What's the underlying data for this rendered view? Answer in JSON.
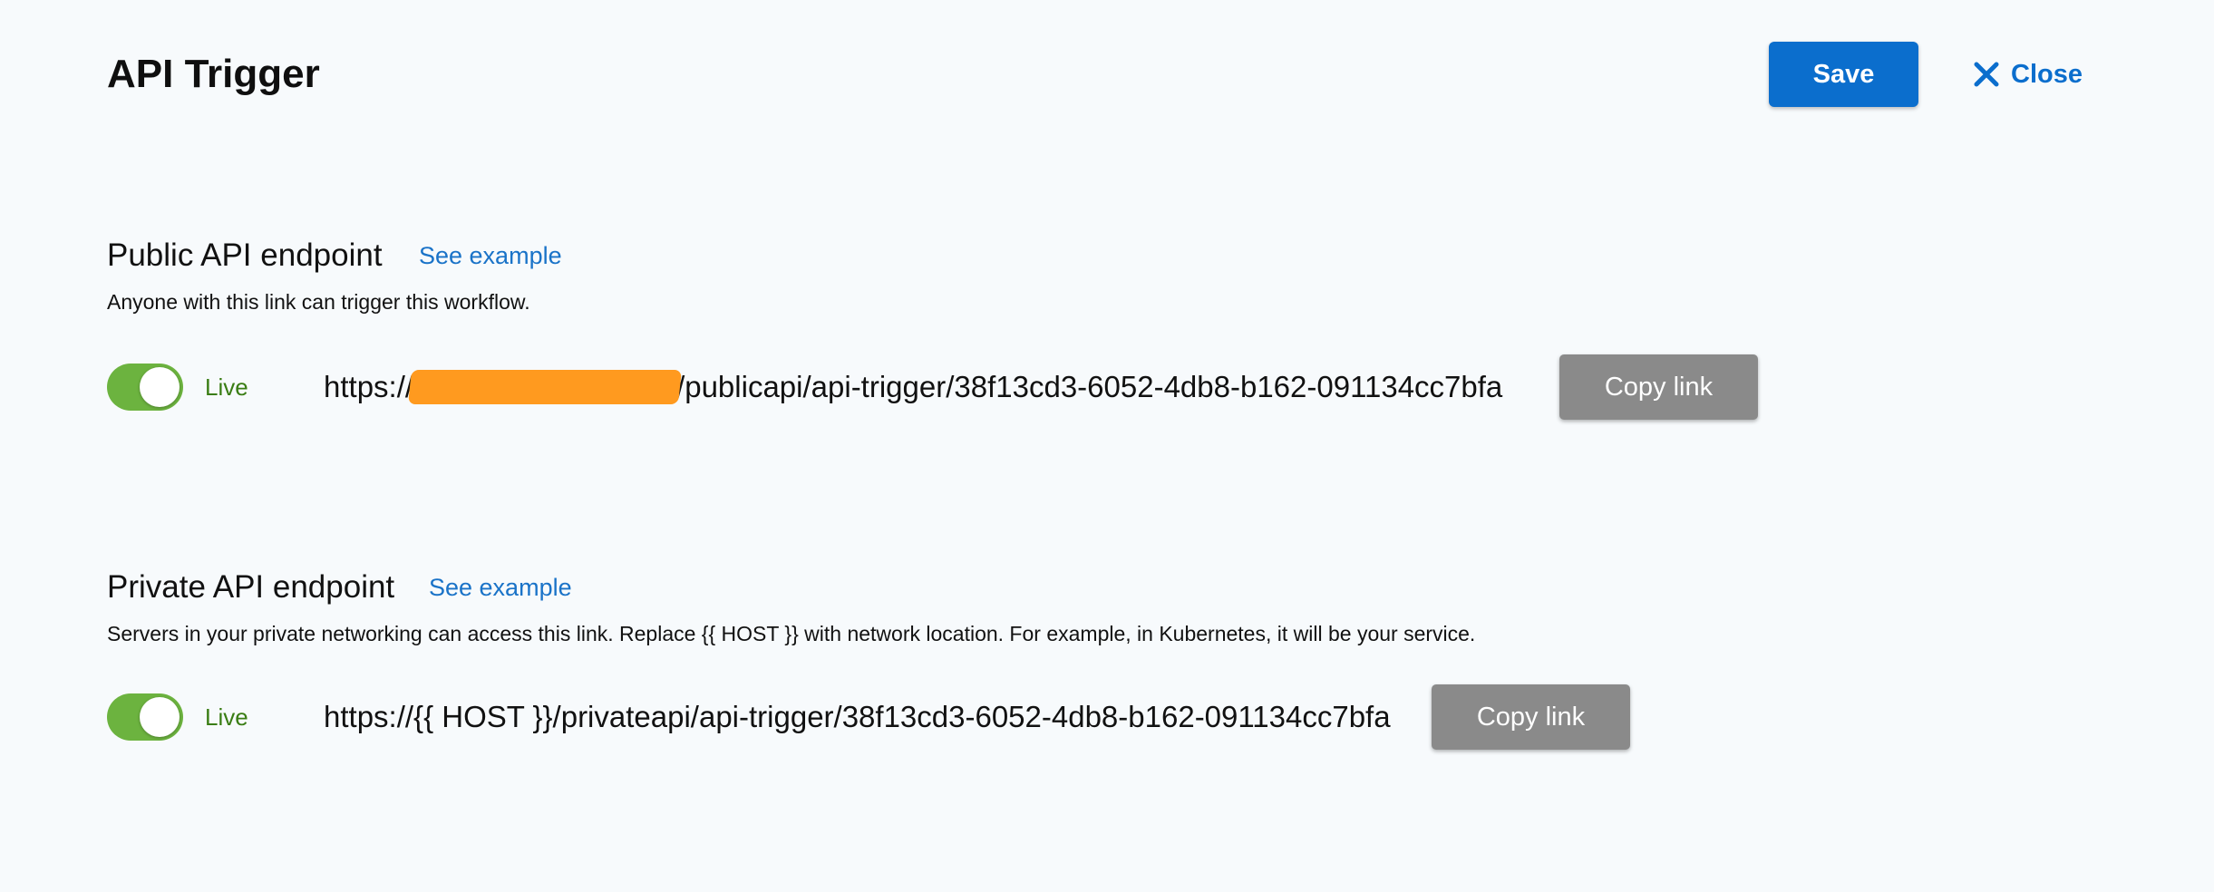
{
  "header": {
    "title": "API Trigger",
    "save_label": "Save",
    "close_label": "Close"
  },
  "public_endpoint": {
    "title": "Public API endpoint",
    "see_example": "See example",
    "description": "Anyone with this link can trigger this workflow.",
    "live_label": "Live",
    "toggle_on": true,
    "url_prefix": "https://",
    "url_suffix": "/publicapi/api-trigger/38f13cd3-6052-4db8-b162-091134cc7bfa",
    "copy_label": "Copy link"
  },
  "private_endpoint": {
    "title": "Private API endpoint",
    "see_example": "See example",
    "description": "Servers in your private networking can access this link. Replace {{ HOST }} with network location. For example, in Kubernetes, it will be your service.",
    "live_label": "Live",
    "toggle_on": true,
    "url": "https://{{ HOST }}/privateapi/api-trigger/38f13cd3-6052-4db8-b162-091134cc7bfa",
    "copy_label": "Copy link"
  },
  "colors": {
    "background": "#f7fafc",
    "primary": "#0b6ecd",
    "toggle_on": "#6cb33f",
    "live_text": "#3a7d14",
    "copy_button": "#8a8a8a",
    "redaction": "#ff9a1f"
  }
}
